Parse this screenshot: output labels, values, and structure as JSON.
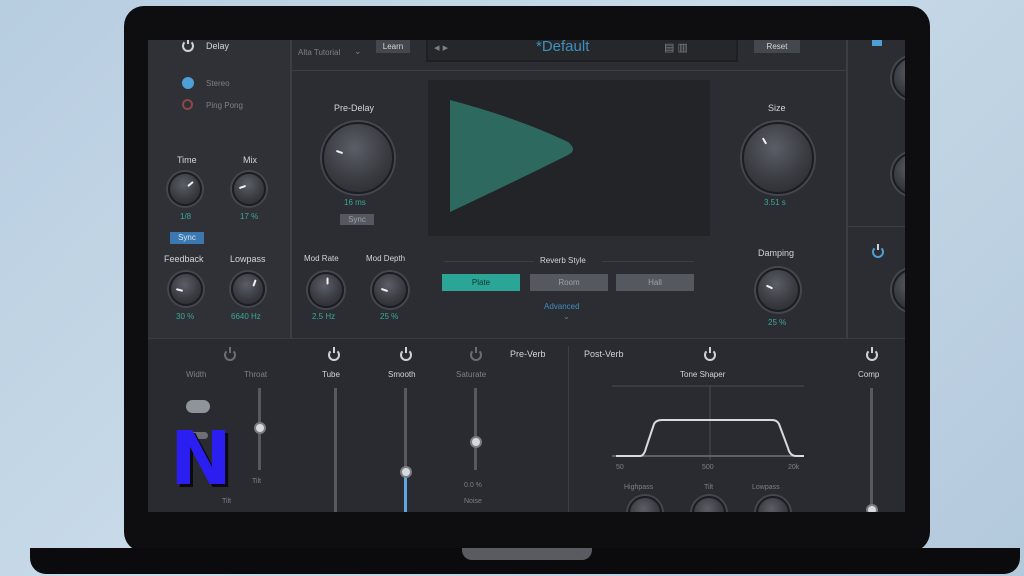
{
  "delay": {
    "title": "Delay",
    "mode_stereo": "Stereo",
    "mode_pingpong": "Ping Pong",
    "time_label": "Time",
    "time_value": "1/8",
    "mix_label": "Mix",
    "mix_value": "17 %",
    "sync_label": "Sync",
    "feedback_label": "Feedback",
    "feedback_value": "30 %",
    "lowpass_label": "Lowpass",
    "lowpass_value": "6640 Hz"
  },
  "header": {
    "midi_menu": "Alta Tutorial",
    "learn_button": "Learn",
    "preset_name": "*Default",
    "reset_button": "Reset"
  },
  "reverb": {
    "predelay_label": "Pre-Delay",
    "predelay_value": "16 ms",
    "predelay_sync": "Sync",
    "size_label": "Size",
    "size_value": "3.51 s",
    "damping_label": "Damping",
    "damping_value": "25 %",
    "modrate_label": "Mod Rate",
    "modrate_value": "2.5 Hz",
    "moddepth_label": "Mod Depth",
    "moddepth_value": "25 %",
    "style_label": "Reverb Style",
    "styles": [
      "Plate",
      "Room",
      "Hall"
    ],
    "advanced_label": "Advanced"
  },
  "preverb": {
    "title": "Pre-Verb",
    "width_label": "Width",
    "tilt_value": "Tilt",
    "throat_label": "Throat",
    "throat_value": "Tilt",
    "tube_label": "Tube",
    "smooth_label": "Smooth",
    "smooth_fill": 0.25,
    "saturate_label": "Saturate",
    "saturate_value": "0.0 %",
    "saturate_sub": "Noise"
  },
  "postverb": {
    "title": "Post-Verb",
    "tone_shaper_label": "Tone Shaper",
    "comp_label": "Comp",
    "axis_left": "50",
    "axis_mid": "500",
    "axis_right": "20k",
    "knob_label_1": "Highpass",
    "knob_label_2": "Tilt",
    "knob_label_3": "Lowpass"
  },
  "watermark": "N",
  "colors": {
    "accent": "#2aa596",
    "wave": "#2e6e62",
    "panel": "#2b2d32",
    "watermark": "#2a1ff0"
  }
}
